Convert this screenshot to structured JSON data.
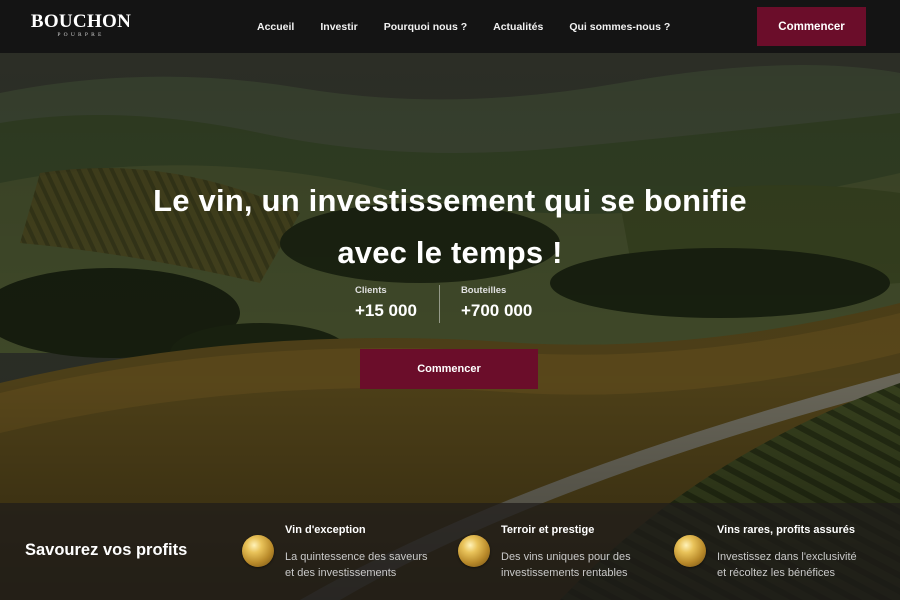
{
  "brand": {
    "name": "BOUCHON",
    "tagline": "POURPRE"
  },
  "nav": {
    "items": [
      {
        "label": "Accueil"
      },
      {
        "label": "Investir"
      },
      {
        "label": "Pourquoi nous ?"
      },
      {
        "label": "Actualités"
      },
      {
        "label": "Qui sommes-nous ?"
      }
    ],
    "cta_label": "Commencer"
  },
  "hero": {
    "title_line1": "Le vin, un investissement qui se bonifie",
    "title_line2": "avec le temps !",
    "stats": [
      {
        "label": "Clients",
        "value": "+15 000"
      },
      {
        "label": "Bouteilles",
        "value": "+700 000"
      }
    ],
    "cta_label": "Commencer"
  },
  "band": {
    "title": "Savourez vos profits",
    "features": [
      {
        "title": "Vin d'exception",
        "line1": "La quintessence des saveurs",
        "line2": "et des investissements",
        "icon": "gold-coin-icon"
      },
      {
        "title": "Terroir et prestige",
        "line1": "Des vins uniques pour des",
        "line2": "investissements rentables",
        "icon": "gold-coin-icon"
      },
      {
        "title": "Vins rares, profits assurés",
        "line1": "Investissez dans l'exclusivité",
        "line2": "et récoltez les bénéfices",
        "icon": "gold-coin-icon"
      }
    ]
  },
  "colors": {
    "accent": "#6b0d2a",
    "header_bg": "#141414",
    "coin_gold": "#d4a53a"
  }
}
